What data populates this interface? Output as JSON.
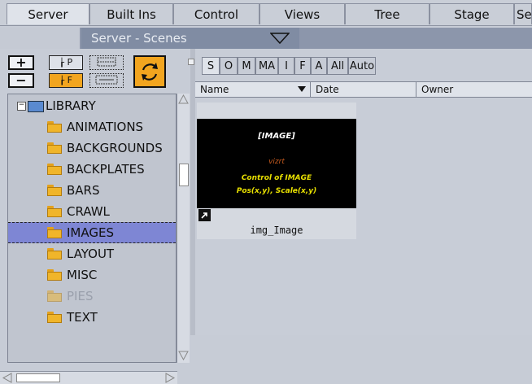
{
  "top_tabs": [
    {
      "label": "Server"
    },
    {
      "label": "Built Ins"
    },
    {
      "label": "Control"
    },
    {
      "label": "Views"
    },
    {
      "label": "Tree"
    },
    {
      "label": "Stage"
    },
    {
      "label": "Se"
    }
  ],
  "header": {
    "title": "Server - Scenes"
  },
  "toolbar": {
    "plus_label": "+",
    "minus_label": "−",
    "p_label": "P",
    "f_label": "F"
  },
  "tree": {
    "root": "LIBRARY",
    "items": [
      {
        "label": "ANIMATIONS"
      },
      {
        "label": "BACKGROUNDS"
      },
      {
        "label": "BACKPLATES"
      },
      {
        "label": "BARS"
      },
      {
        "label": "CRAWL"
      },
      {
        "label": "IMAGES"
      },
      {
        "label": "LAYOUT"
      },
      {
        "label": "MISC"
      },
      {
        "label": "PIES"
      },
      {
        "label": "TEXT"
      }
    ]
  },
  "filter_tabs": [
    "S",
    "O",
    "M",
    "MA",
    "I",
    "F",
    "A",
    "All",
    "Auto"
  ],
  "columns": {
    "name": "Name",
    "date": "Date",
    "owner": "Owner"
  },
  "item": {
    "label": "img_Image",
    "thumb_line1": "[IMAGE]",
    "thumb_logo": "vizrt",
    "thumb_line2": "Control of IMAGE",
    "thumb_line3": "Pos(x,y), Scale(x,y)"
  },
  "colors": {
    "selection": "#7e86d4",
    "folder": "#f0b52a",
    "thumb_text": "#e8e000"
  }
}
